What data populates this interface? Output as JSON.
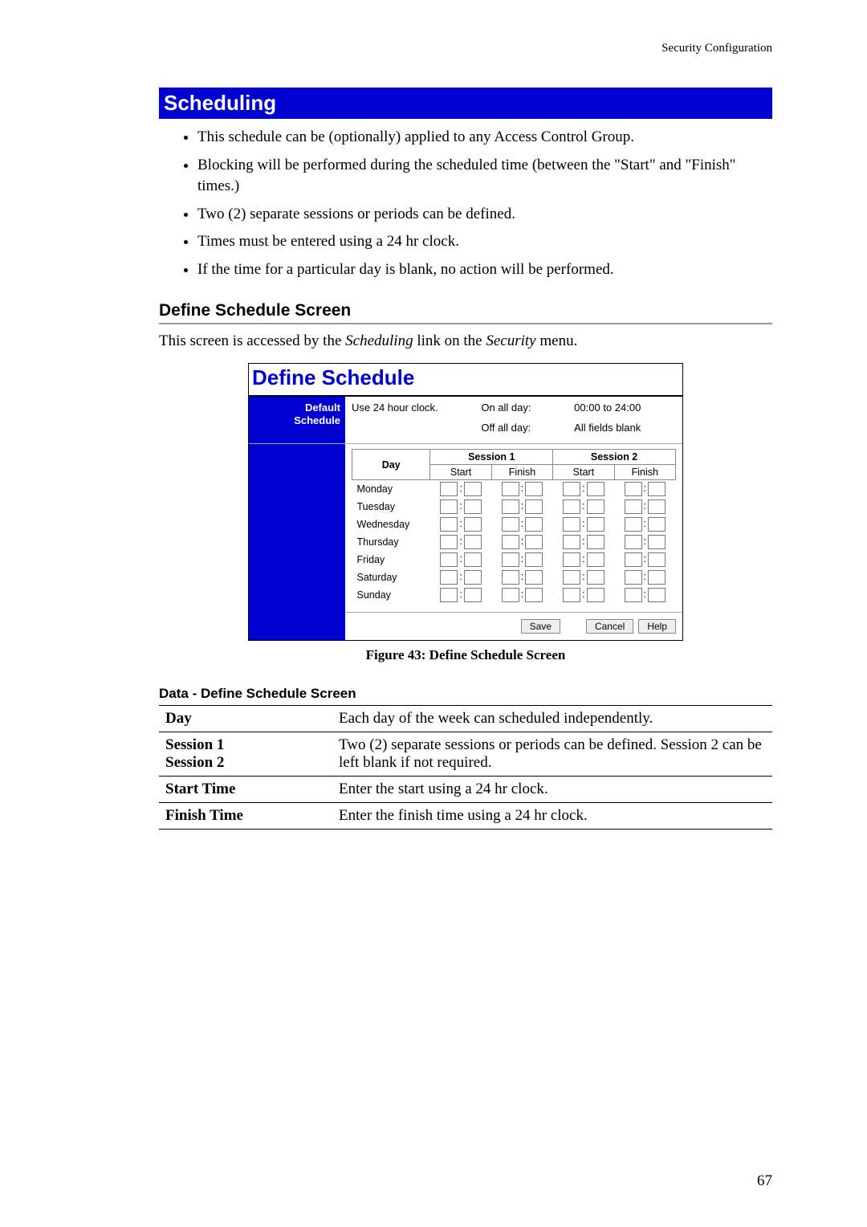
{
  "header": "Security Configuration",
  "section_title": "Scheduling",
  "bullets": [
    "This schedule can be (optionally) applied to any Access Control Group.",
    "Blocking will be performed during the scheduled time (between the \"Start\" and \"Finish\" times.)",
    "Two (2) separate sessions or periods can be defined.",
    "Times must be entered using a 24 hr clock.",
    "If the time for a particular day is blank, no action will be performed."
  ],
  "subheading1": "Define Schedule Screen",
  "intro_pre": "This screen is accessed by the ",
  "intro_i1": "Scheduling",
  "intro_mid": " link on the ",
  "intro_i2": "Security",
  "intro_post": " menu.",
  "screenshot": {
    "title": "Define Schedule",
    "side_label1": "Default",
    "side_label2": "Schedule",
    "clock_note": "Use 24 hour clock.",
    "on_label": "On all day:",
    "on_value": "00:00 to 24:00",
    "off_label": "Off all day:",
    "off_value": "All fields blank",
    "day_head": "Day",
    "session1": "Session 1",
    "session2": "Session 2",
    "start": "Start",
    "finish": "Finish",
    "days": [
      "Monday",
      "Tuesday",
      "Wednesday",
      "Thursday",
      "Friday",
      "Saturday",
      "Sunday"
    ],
    "btn_save": "Save",
    "btn_cancel": "Cancel",
    "btn_help": "Help"
  },
  "figure_caption": "Figure 43: Define Schedule Screen",
  "subheading2": "Data - Define Schedule Screen",
  "data_table": [
    {
      "label": "Day",
      "desc": "Each day of the week can scheduled independently."
    },
    {
      "label": "Session 1\nSession 2",
      "desc": "Two (2) separate sessions or periods can be defined. Session 2 can be left blank if not required."
    },
    {
      "label": "Start Time",
      "desc": "Enter the start using a 24 hr clock."
    },
    {
      "label": "Finish Time",
      "desc": "Enter the finish time using a 24 hr clock."
    }
  ],
  "page_number": "67"
}
